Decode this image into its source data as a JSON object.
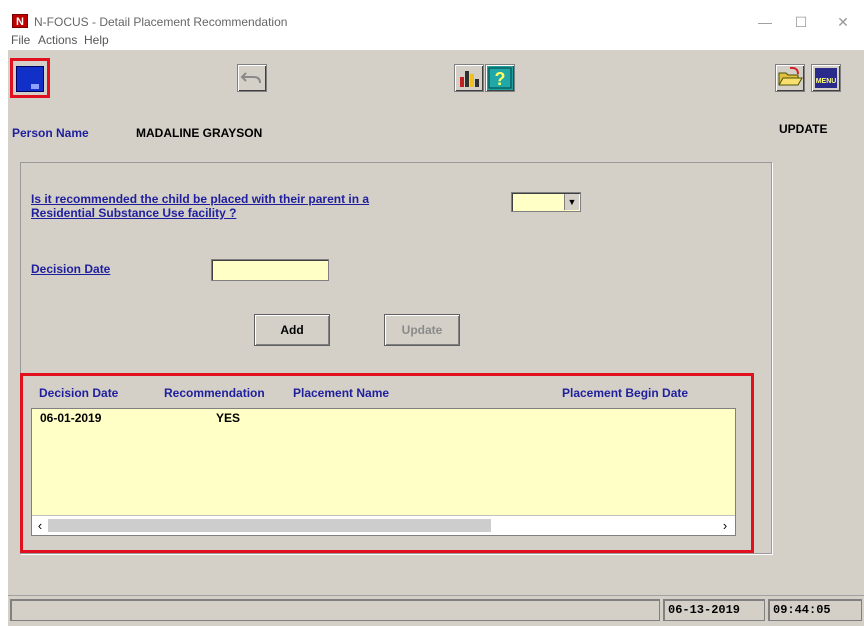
{
  "window": {
    "app_icon_letter": "N",
    "title": "N-FOCUS - Detail Placement Recommendation",
    "controls": {
      "minimize": "—",
      "maximize": "☐",
      "close": "✕"
    }
  },
  "menubar": {
    "items": [
      "File",
      "Actions",
      "Help"
    ]
  },
  "toolbar": {
    "icons": [
      "save-icon",
      "back-arrow-icon",
      "chart-icon",
      "help-icon",
      "folder-open-icon",
      "menu-icon"
    ],
    "menu_icon_text": "MENU"
  },
  "header": {
    "person_label": "Person Name",
    "person_value": "MADALINE GRAYSON",
    "mode": "UPDATE"
  },
  "form": {
    "question_line1": "Is it recommended the child be placed with their parent in a",
    "question_line2": "Residential Substance Use facility ?",
    "question_value": "",
    "decision_date_label": "Decision Date",
    "decision_date_value": "",
    "add_label": "Add",
    "update_label": "Update"
  },
  "grid": {
    "columns": [
      "Decision Date",
      "Recommendation",
      "Placement Name",
      "Placement Begin Date"
    ],
    "rows": [
      {
        "decision_date": "06-01-2019",
        "recommendation": "YES",
        "placement_name": "",
        "placement_begin_date": ""
      }
    ],
    "scroll_left": "‹",
    "scroll_right": "›"
  },
  "status": {
    "date": "06-13-2019",
    "time": "09:44:05"
  },
  "colors": {
    "highlight": "#e0101f",
    "field_bg": "#ffffc6",
    "label_blue": "#1f1f9e",
    "panel": "#d4d0c8"
  }
}
